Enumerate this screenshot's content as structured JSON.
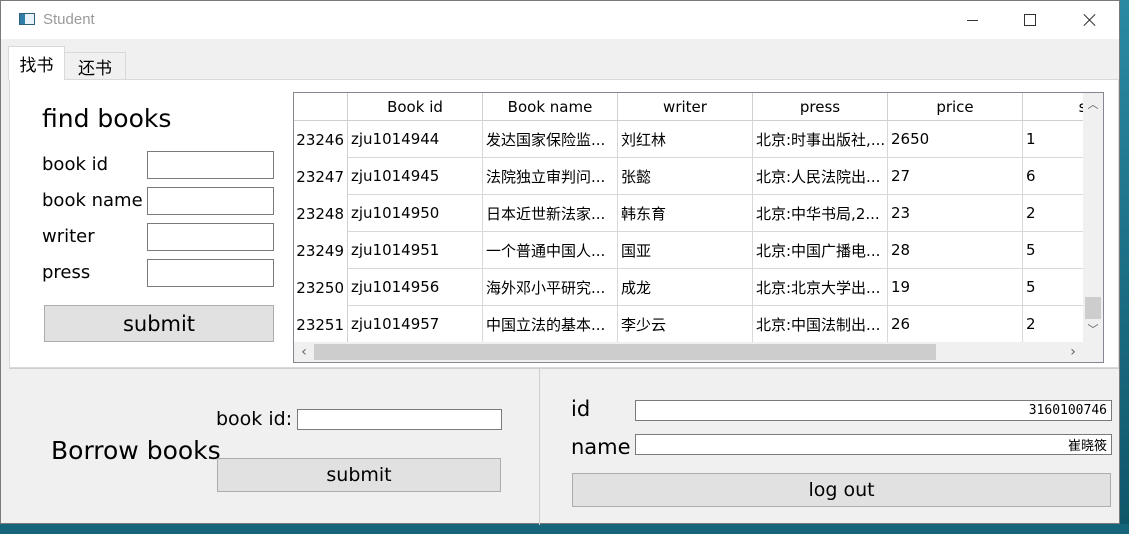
{
  "window": {
    "title": "Student",
    "minimize_icon": "minimize-icon",
    "maximize_icon": "maximize-icon",
    "close_icon": "close-icon"
  },
  "tabs": [
    {
      "label": "找书",
      "active": true
    },
    {
      "label": "还书",
      "active": false
    }
  ],
  "find": {
    "title": "find books",
    "fields": [
      {
        "label": "book id",
        "value": ""
      },
      {
        "label": "book name",
        "value": ""
      },
      {
        "label": "writer",
        "value": ""
      },
      {
        "label": "press",
        "value": ""
      }
    ],
    "submit_label": "submit"
  },
  "table": {
    "columns": [
      "Book id",
      "Book name",
      "writer",
      "press",
      "price",
      "sto"
    ],
    "rows": [
      {
        "num": "23246",
        "cells": [
          "zju1014944",
          "发达国家保险监...",
          "刘红林",
          "北京:时事出版社,...",
          "2650",
          "1"
        ]
      },
      {
        "num": "23247",
        "cells": [
          "zju1014945",
          "法院独立审判问...",
          "张懿",
          "北京:人民法院出...",
          "27",
          "6"
        ]
      },
      {
        "num": "23248",
        "cells": [
          "zju1014950",
          "日本近世新法家...",
          "韩东育",
          "北京:中华书局,2...",
          "23",
          "2"
        ]
      },
      {
        "num": "23249",
        "cells": [
          "zju1014951",
          "一个普通中国人...",
          "国亚",
          "北京:中国广播电...",
          "28",
          "5"
        ]
      },
      {
        "num": "23250",
        "cells": [
          "zju1014956",
          "海外邓小平研究...",
          "成龙",
          "北京:北京大学出...",
          "19",
          "5"
        ]
      },
      {
        "num": "23251",
        "cells": [
          "zju1014957",
          "中国立法的基本...",
          "李少云",
          "北京:中国法制出...",
          "26",
          "2"
        ]
      }
    ]
  },
  "borrow": {
    "title": "Borrow books",
    "book_id_label": "book id:",
    "book_id_value": "",
    "submit_label": "submit"
  },
  "user": {
    "id_label": "id",
    "id_value": "3160100746",
    "name_label": "name",
    "name_value": "崔晓筱",
    "logout_label": "log out"
  }
}
